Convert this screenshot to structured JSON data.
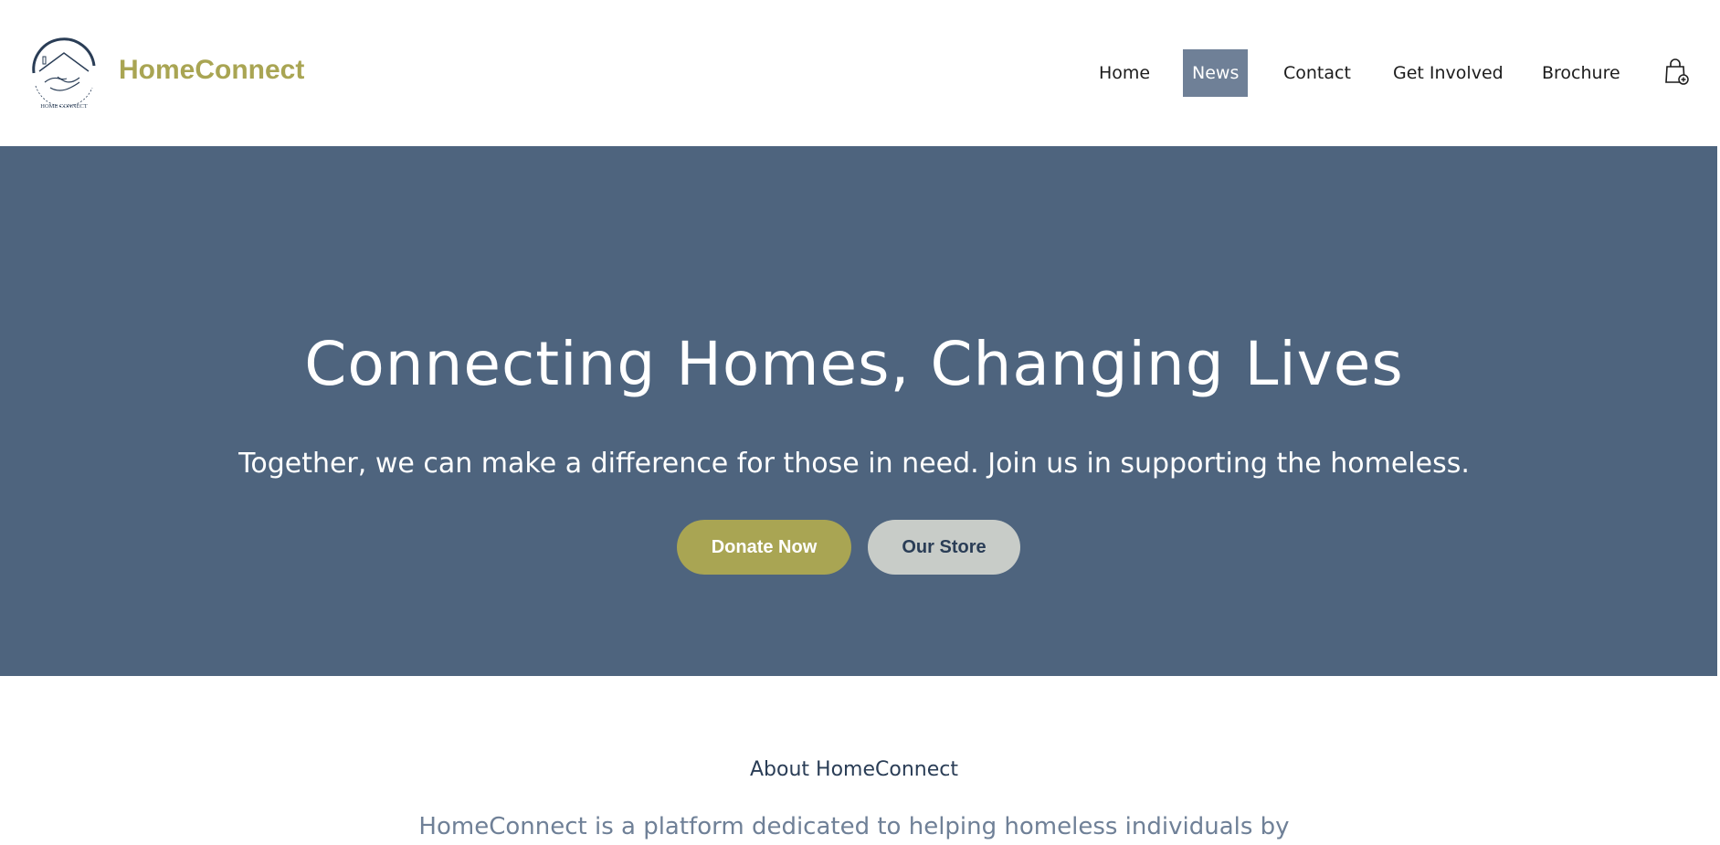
{
  "header": {
    "brand": "HomeConnect",
    "logo_text": "HOME CONNECT",
    "nav": [
      {
        "label": "Home",
        "active": false
      },
      {
        "label": "News",
        "active": true
      },
      {
        "label": "Contact",
        "active": false
      },
      {
        "label": "Get Involved",
        "active": false
      },
      {
        "label": "Brochure",
        "active": false
      }
    ],
    "cart_icon": "shopping-bag-icon"
  },
  "hero": {
    "title": "Connecting Homes, Changing Lives",
    "subtitle": "Together, we can make a difference for those in need. Join us in supporting the homeless.",
    "donate_label": "Donate Now",
    "store_label": "Our Store"
  },
  "about": {
    "title": "About HomeConnect",
    "text": "HomeConnect is a platform dedicated to helping homeless individuals by"
  },
  "colors": {
    "brand": "#a9a553",
    "hero_bg": "#4e647e",
    "nav_active_bg": "#6f8097",
    "store_button_bg": "#c8ccc8",
    "heading_dark": "#2a3d56"
  }
}
